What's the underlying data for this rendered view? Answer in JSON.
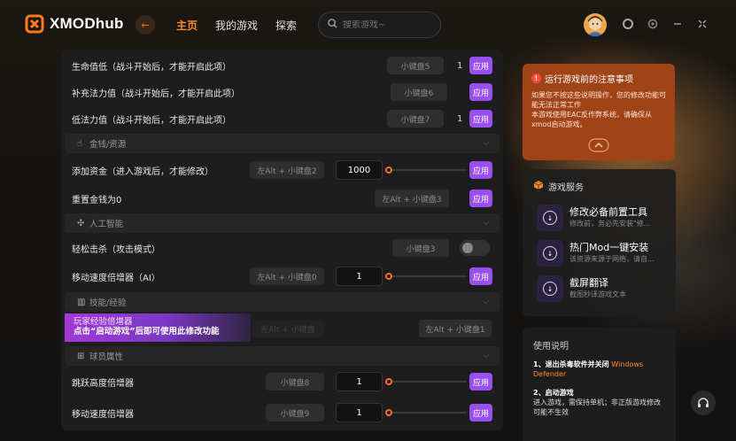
{
  "app": {
    "logo_text": "XMODhub"
  },
  "nav": {
    "home": "主页",
    "my_games": "我的游戏",
    "explore": "探索"
  },
  "search": {
    "placeholder": "搜索游戏~"
  },
  "colors": {
    "accent": "#ff8a2a",
    "apply": "#9a4ff0",
    "notice": "#a04418"
  },
  "rows": [
    {
      "label": "生命值低（战斗开始后，才能开启此项）",
      "key": "小键盘5",
      "count": "1",
      "apply": "应用"
    },
    {
      "label": "补充法力值（战斗开始后，才能开启此项）",
      "key": "小键盘6",
      "apply": "应用"
    },
    {
      "label": "低法力值（战斗开始后，才能开启此项）",
      "key": "小键盘7",
      "count": "1",
      "apply": "应用"
    }
  ],
  "sections": {
    "money": "金钱/资源",
    "ai": "人工智能",
    "skills": "技能/经验",
    "player": "球员属性"
  },
  "money_rows": [
    {
      "label": "添加资金（进入游戏后，才能修改）",
      "key": "左Alt + 小键盘2",
      "value": "1000",
      "apply": "应用"
    },
    {
      "label": "重置金钱为0",
      "key": "左Alt + 小键盘3",
      "apply": "应用"
    }
  ],
  "ai_rows": [
    {
      "label": "轻松击杀（攻击模式）",
      "key": "小键盘3"
    },
    {
      "label": "移动速度倍增器（AI）",
      "key": "左Alt + 小键盘0",
      "value": "1",
      "apply": "应用"
    }
  ],
  "skill_row": {
    "label": "玩家经验倍增器",
    "key_left": "左Alt + 小键盘",
    "key_right": "左Alt + 小键盘1",
    "banner": "点击“启动游戏”后即可使用此修改功能"
  },
  "player_rows": [
    {
      "label": "跳跃高度倍增器",
      "key": "小键盘8",
      "value": "1",
      "apply": "应用"
    },
    {
      "label": "移动速度倍增器",
      "key": "小键盘9",
      "value": "1",
      "apply": "应用"
    }
  ],
  "notice": {
    "title": "运行游戏前的注意事项",
    "body": "如果您不按这些说明操作，您的修改功能可能无法正常工作\n本游戏使用EAC反作弊系统，请确保从xmod启动游戏。"
  },
  "services": {
    "title": "游戏服务",
    "items": [
      {
        "name": "修改必备前置工具",
        "desc": "修改前，务必先安装\"修..."
      },
      {
        "name": "热门Mod一键安装",
        "desc": "该资源来源于网络，请自..."
      },
      {
        "name": "截屏翻译",
        "desc": "截图秒译游戏文本"
      }
    ]
  },
  "help": {
    "title": "使用说明",
    "step1": "1、退出杀毒软件并关闭",
    "step1_hl": "Windows Defender",
    "step2": "2、启动游戏",
    "step2_sub": "进入游戏，需保持单机；非正版游戏修改可能不生效"
  }
}
